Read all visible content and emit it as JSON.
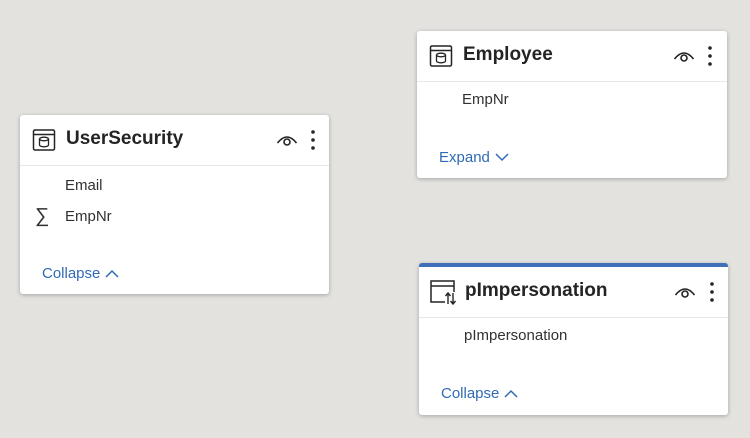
{
  "tables": [
    {
      "name": "UserSecurity",
      "fields": [
        {
          "label": "Email"
        },
        {
          "label": "EmpNr",
          "prefix": "∑"
        }
      ],
      "toggle": "Collapse"
    },
    {
      "name": "Employee",
      "fields": [
        {
          "label": "EmpNr"
        }
      ],
      "toggle": "Expand"
    },
    {
      "name": "pImpersonation",
      "fields": [
        {
          "label": "pImpersonation"
        }
      ],
      "toggle": "Collapse"
    }
  ],
  "colors": {
    "canvas": "#e3e2df",
    "card": "#ffffff",
    "accent": "#3e6fb8",
    "link": "#2f6bb4"
  },
  "icons": [
    "table-icon",
    "parameter-table-icon",
    "eye-icon",
    "more-options-icon",
    "chevron-up-icon",
    "chevron-down-icon",
    "sum-icon"
  ]
}
